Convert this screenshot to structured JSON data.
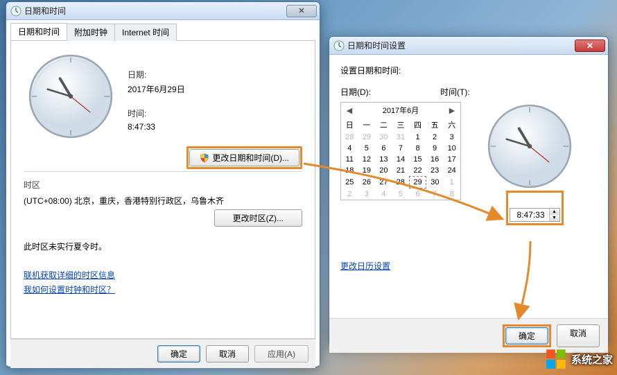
{
  "win1": {
    "title": "日期和时间",
    "tabs": [
      "日期和时间",
      "附加时钟",
      "Internet 时间"
    ],
    "date_label": "日期:",
    "date_value": "2017年6月29日",
    "time_label": "时间:",
    "time_value": "8:47:33",
    "change_dt_button": "更改日期和时间(D)...",
    "tz_section": "时区",
    "tz_value": "(UTC+08:00) 北京，重庆，香港特别行政区，乌鲁木齐",
    "change_tz_button": "更改时区(Z)...",
    "dst_note": "此时区未实行夏令时。",
    "link1": "联机获取详细的时区信息",
    "link2": "我如何设置时钟和时区？",
    "ok": "确定",
    "cancel": "取消",
    "apply": "应用(A)"
  },
  "win2": {
    "title": "日期和时间设置",
    "heading": "设置日期和时间:",
    "date_label": "日期(D):",
    "time_label": "时间(T):",
    "cal_month": "2017年6月",
    "weekdays": [
      "日",
      "一",
      "二",
      "三",
      "四",
      "五",
      "六"
    ],
    "calendar": [
      [
        {
          "d": 28,
          "o": true
        },
        {
          "d": 29,
          "o": true
        },
        {
          "d": 30,
          "o": true
        },
        {
          "d": 31,
          "o": true
        },
        {
          "d": 1
        },
        {
          "d": 2
        },
        {
          "d": 3
        }
      ],
      [
        {
          "d": 4
        },
        {
          "d": 5
        },
        {
          "d": 6
        },
        {
          "d": 7
        },
        {
          "d": 8
        },
        {
          "d": 9
        },
        {
          "d": 10
        }
      ],
      [
        {
          "d": 11
        },
        {
          "d": 12
        },
        {
          "d": 13
        },
        {
          "d": 14
        },
        {
          "d": 15
        },
        {
          "d": 16
        },
        {
          "d": 17
        }
      ],
      [
        {
          "d": 18
        },
        {
          "d": 19
        },
        {
          "d": 20
        },
        {
          "d": 21
        },
        {
          "d": 22
        },
        {
          "d": 23
        },
        {
          "d": 24
        }
      ],
      [
        {
          "d": 25
        },
        {
          "d": 26
        },
        {
          "d": 27
        },
        {
          "d": 28
        },
        {
          "d": 29,
          "t": true
        },
        {
          "d": 30
        },
        {
          "d": 1,
          "o": true
        }
      ],
      [
        {
          "d": 2,
          "o": true
        },
        {
          "d": 3,
          "o": true
        },
        {
          "d": 4,
          "o": true
        },
        {
          "d": 5,
          "o": true
        },
        {
          "d": 6,
          "o": true
        },
        {
          "d": 7,
          "o": true
        },
        {
          "d": 8,
          "o": true
        }
      ]
    ],
    "time_value": "8:47:33",
    "link": "更改日历设置",
    "ok": "确定",
    "cancel": "取消"
  },
  "watermark": "系统之家"
}
